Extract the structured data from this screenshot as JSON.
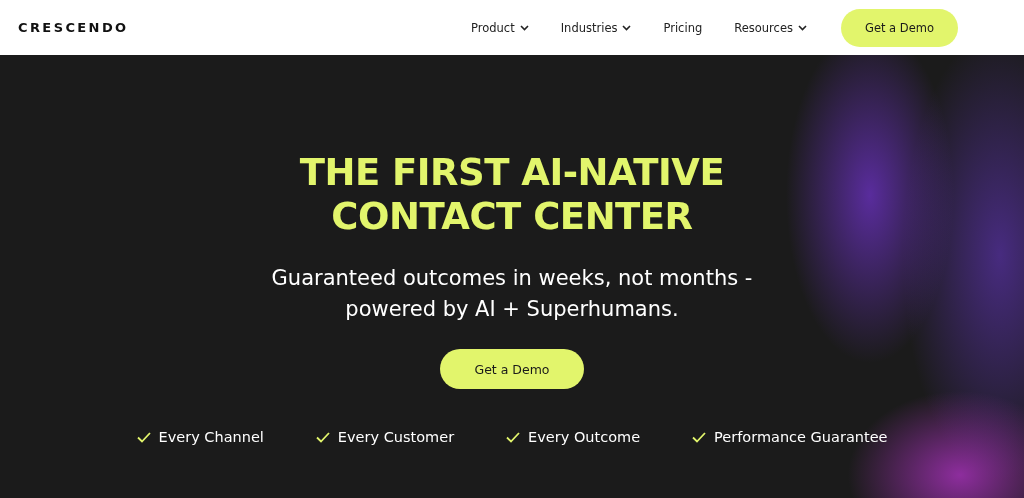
{
  "header": {
    "logo": "CRESCENDO",
    "nav": [
      {
        "label": "Product",
        "kind": "dropdown"
      },
      {
        "label": "Industries",
        "kind": "dropdown"
      },
      {
        "label": "Pricing",
        "kind": "link"
      },
      {
        "label": "Resources",
        "kind": "dropdown"
      }
    ],
    "cta": "Get a Demo"
  },
  "hero": {
    "headline_lines": [
      "THE FIRST AI-NATIVE",
      "CONTACT CENTER"
    ],
    "subtitle_lines": [
      "Guaranteed outcomes in weeks, not months -",
      "powered by AI + Superhumans."
    ],
    "cta": "Get a Demo",
    "features": [
      "Every Channel",
      "Every Customer",
      "Every Outcome",
      "Performance Guarantee"
    ]
  }
}
